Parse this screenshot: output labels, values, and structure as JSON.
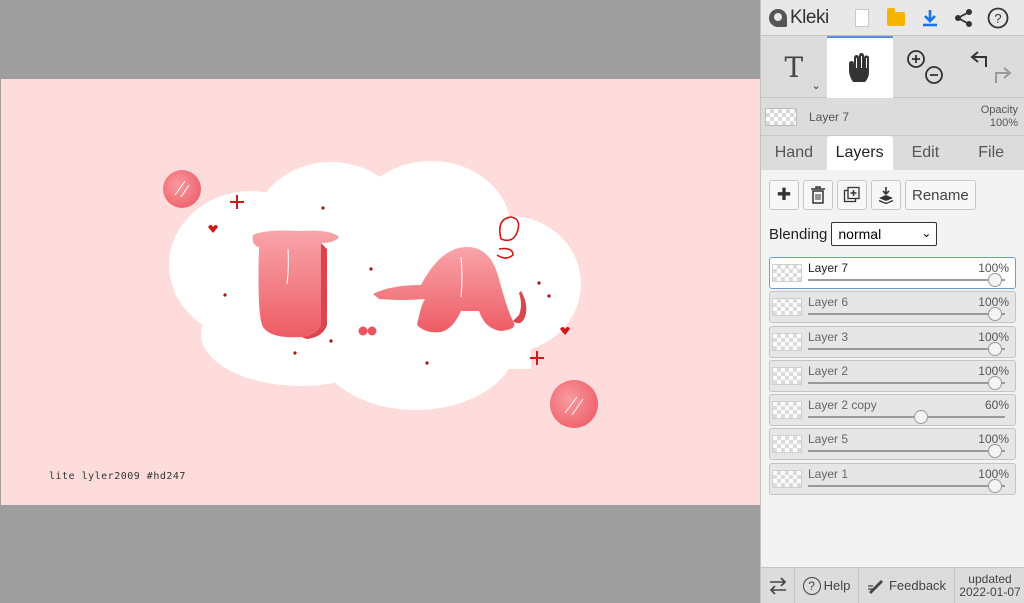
{
  "canvas": {
    "signature": "lite   lyler2009   #hd247",
    "background": "#ffdcdc"
  },
  "topbar": {
    "logo": "Kleki",
    "icons": [
      "new-document-icon",
      "open-folder-icon",
      "download-icon",
      "share-icon",
      "help-icon"
    ]
  },
  "tools": {
    "text": "T",
    "active": "hand",
    "items": [
      "text-tool",
      "hand-tool",
      "zoom-tool",
      "undo-redo"
    ]
  },
  "layer_info": {
    "name": "Layer 7",
    "opacity_label": "Opacity",
    "opacity_value": "100%"
  },
  "tabs": [
    {
      "label": "Hand"
    },
    {
      "label": "Layers"
    },
    {
      "label": "Edit"
    },
    {
      "label": "File"
    }
  ],
  "layer_actions": {
    "rename": "Rename"
  },
  "blending": {
    "label": "Blending",
    "value": "normal"
  },
  "layers": [
    {
      "name": "Layer 7",
      "opacity": "100%",
      "level": 1.0,
      "selected": true
    },
    {
      "name": "Layer 6",
      "opacity": "100%",
      "level": 1.0
    },
    {
      "name": "Layer 3",
      "opacity": "100%",
      "level": 1.0
    },
    {
      "name": "Layer 2",
      "opacity": "100%",
      "level": 1.0
    },
    {
      "name": "Layer 2 copy",
      "opacity": "60%",
      "level": 0.6
    },
    {
      "name": "Layer 5",
      "opacity": "100%",
      "level": 1.0
    },
    {
      "name": "Layer 1",
      "opacity": "100%",
      "level": 1.0
    }
  ],
  "bottombar": {
    "help": "Help",
    "feedback": "Feedback",
    "updated_line1": "updated",
    "updated_line2": "2022-01-07"
  },
  "colors": {
    "accent": "#1a73e8",
    "selected_border": "#6f9ad8",
    "letter_pink": "#f07f86"
  }
}
